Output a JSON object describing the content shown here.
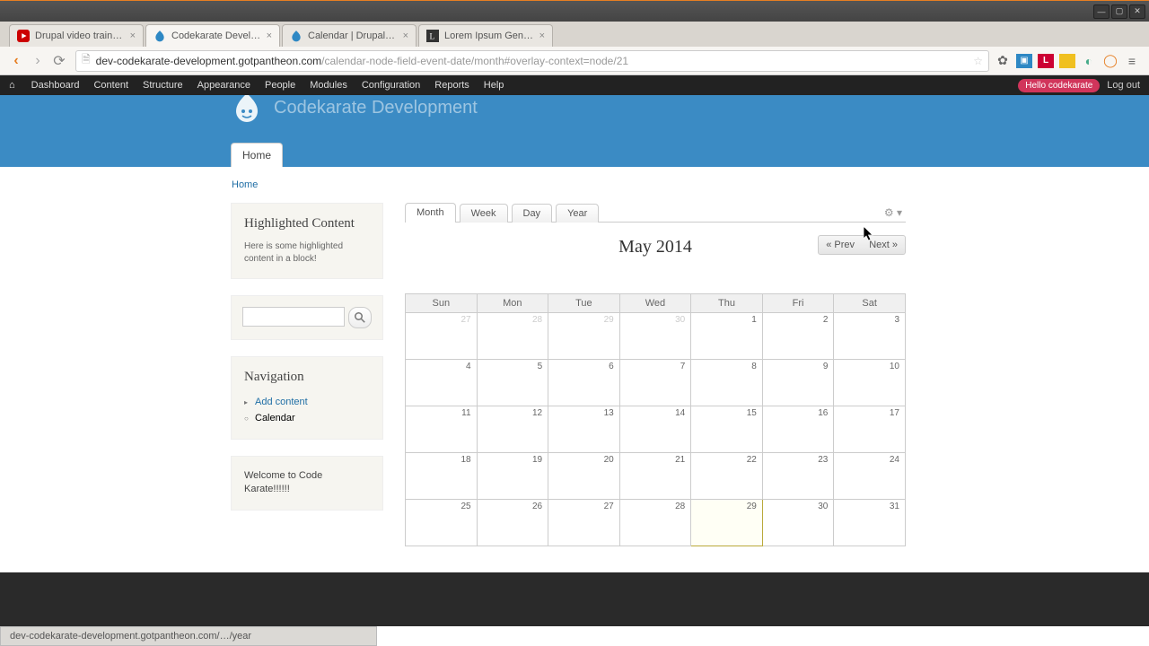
{
  "browser": {
    "tabs": [
      {
        "label": "Drupal video training…"
      },
      {
        "label": "Codekarate Developm"
      },
      {
        "label": "Calendar | Drupal.org"
      },
      {
        "label": "Lorem Ipsum Generat"
      }
    ],
    "url_domain": "dev-codekarate-development.gotpantheon.com",
    "url_path": "/calendar-node-field-event-date/month#overlay-context=node/21",
    "status_text": "dev-codekarate-development.gotpantheon.com/…/year"
  },
  "admin_menu": {
    "items": [
      "Dashboard",
      "Content",
      "Structure",
      "Appearance",
      "People",
      "Modules",
      "Configuration",
      "Reports",
      "Help"
    ],
    "hello": "Hello codekarate",
    "logout": "Log out"
  },
  "site": {
    "title": "Codekarate Development",
    "home_tab": "Home",
    "breadcrumb": "Home"
  },
  "sidebar": {
    "highlighted_title": "Highlighted Content",
    "highlighted_text": "Here is some highlighted content in a block!",
    "nav_title": "Navigation",
    "nav_add": "Add content",
    "nav_cal": "Calendar",
    "welcome": "Welcome to Code Karate!!!!!!"
  },
  "calendar": {
    "tabs": [
      "Month",
      "Week",
      "Day",
      "Year"
    ],
    "active_tab": "Month",
    "title": "May 2014",
    "prev": "« Prev",
    "next": "Next »",
    "day_headers": [
      "Sun",
      "Mon",
      "Tue",
      "Wed",
      "Thu",
      "Fri",
      "Sat"
    ],
    "weeks": [
      [
        {
          "d": "27",
          "o": true
        },
        {
          "d": "28",
          "o": true
        },
        {
          "d": "29",
          "o": true
        },
        {
          "d": "30",
          "o": true
        },
        {
          "d": "1"
        },
        {
          "d": "2"
        },
        {
          "d": "3"
        }
      ],
      [
        {
          "d": "4"
        },
        {
          "d": "5"
        },
        {
          "d": "6"
        },
        {
          "d": "7"
        },
        {
          "d": "8"
        },
        {
          "d": "9"
        },
        {
          "d": "10"
        }
      ],
      [
        {
          "d": "11"
        },
        {
          "d": "12"
        },
        {
          "d": "13"
        },
        {
          "d": "14"
        },
        {
          "d": "15"
        },
        {
          "d": "16"
        },
        {
          "d": "17"
        }
      ],
      [
        {
          "d": "18"
        },
        {
          "d": "19"
        },
        {
          "d": "20"
        },
        {
          "d": "21"
        },
        {
          "d": "22"
        },
        {
          "d": "23"
        },
        {
          "d": "24"
        }
      ],
      [
        {
          "d": "25"
        },
        {
          "d": "26"
        },
        {
          "d": "27"
        },
        {
          "d": "28"
        },
        {
          "d": "29",
          "t": true
        },
        {
          "d": "30"
        },
        {
          "d": "31"
        }
      ]
    ]
  }
}
